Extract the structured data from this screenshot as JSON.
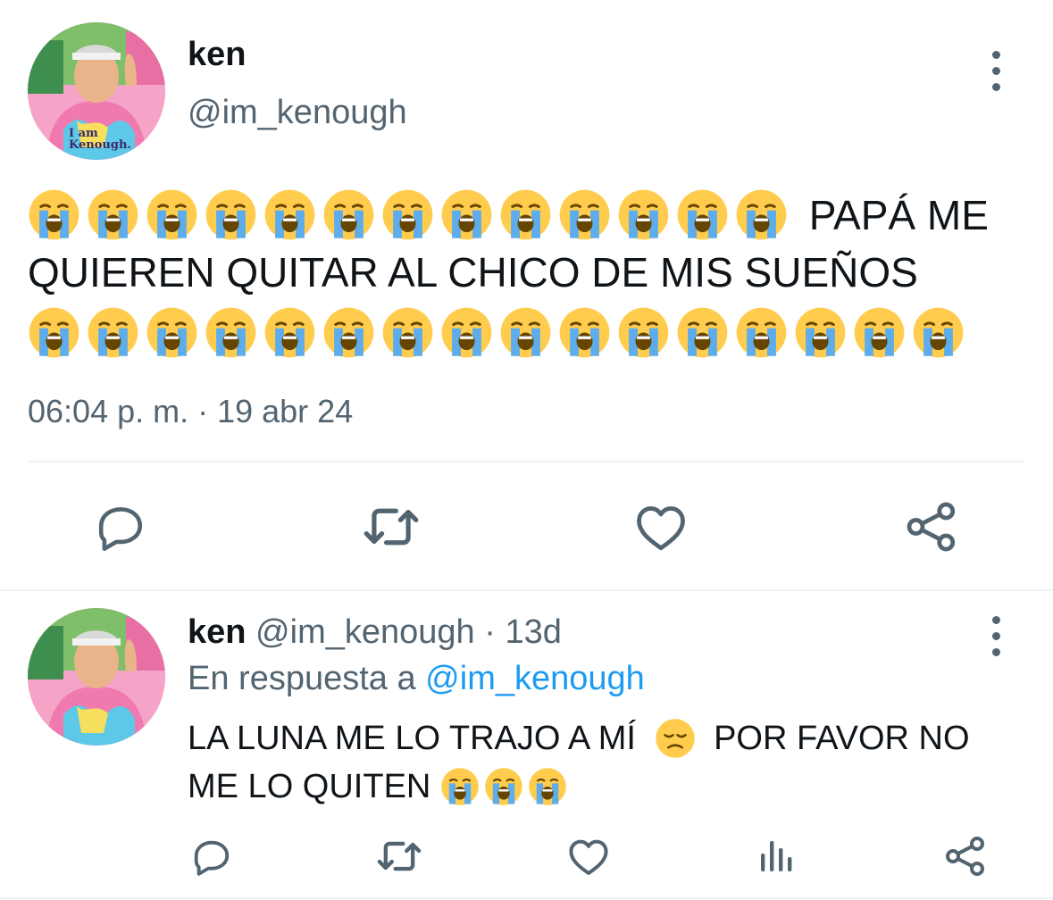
{
  "main_tweet": {
    "author_name": "ken",
    "handle": "@im_kenough",
    "avatar_caption": "I am Kenough.",
    "text": "PAPÁ ME QUIEREN QUITAR AL CHICO DE MIS SUEÑOS",
    "text_line1": "PAPÁ ME",
    "text_line2": "QUIEREN QUITAR AL CHICO DE MIS SUEÑOS",
    "emoji_before_count": 13,
    "emoji_after_count": 16,
    "emoji": "loudly-crying-face",
    "timestamp": "06:04 p. m. · 19 abr 24",
    "actions": [
      "reply-icon",
      "retweet-icon",
      "like-icon",
      "share-icon"
    ]
  },
  "reply_tweet": {
    "author_name": "ken",
    "handle": "@im_kenough",
    "separator": "·",
    "age": "13d",
    "replying_prefix": "En respuesta a",
    "replying_to": "@im_kenough",
    "text_line1_a": "LA LUNA ME LO TRAJO A MÍ",
    "text_line1_b": "POR FAVOR NO",
    "text_line2": "ME LO QUITEN",
    "inline_emoji": "disappointed-face",
    "trailing_emoji_count": 3,
    "actions": [
      "reply-icon",
      "retweet-icon",
      "like-icon",
      "views-icon",
      "share-icon"
    ]
  },
  "colors": {
    "text": "#0f1419",
    "secondary": "#536471",
    "link": "#1d9bf0",
    "divider": "#eff3f4",
    "emoji_face": "#ffcc4d",
    "emoji_tears": "#5dadec"
  }
}
